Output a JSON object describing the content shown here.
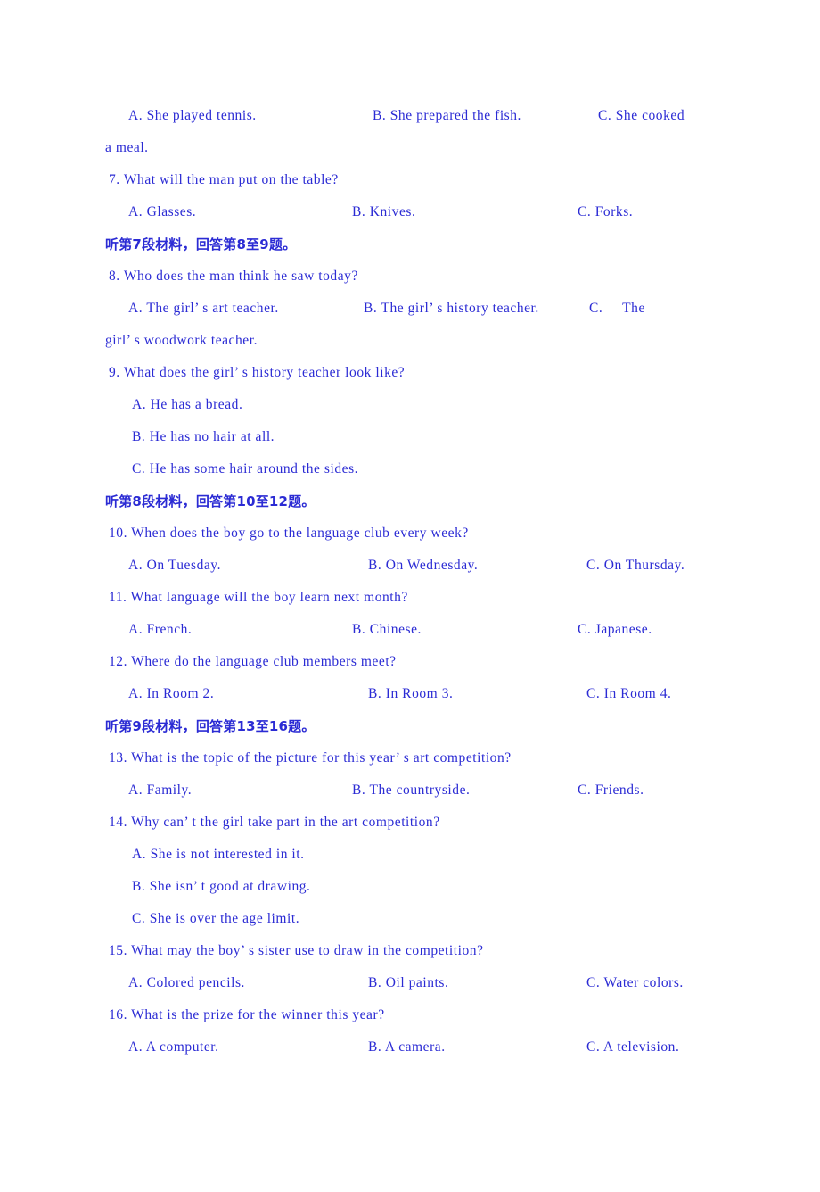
{
  "document": {
    "type": "listening-comprehension-exam-page",
    "language": "English with Chinese instructions",
    "text_color": "#2b2bd4",
    "background_color": "#ffffff"
  },
  "lines": [
    {
      "id": "q6-options",
      "kind": "options-row",
      "a": "A. She played tennis.",
      "b": "B. She prepared the fish.",
      "c": "C. She cooked"
    },
    {
      "id": "q6-continuation",
      "kind": "continuation",
      "text": "a meal."
    },
    {
      "id": "q7-stem",
      "kind": "stem",
      "text": "7. What will the man put on the table?"
    },
    {
      "id": "q7-options",
      "kind": "options-row",
      "a": "A. Glasses.",
      "b": "B. Knives.",
      "c": "C. Forks."
    },
    {
      "id": "section-7-header",
      "kind": "cn-header",
      "text": "听第7段材料，回答第8至9题。"
    },
    {
      "id": "q8-stem",
      "kind": "stem",
      "text": "8. Who does the man think he saw today?"
    },
    {
      "id": "q8-options",
      "kind": "options-row",
      "a": "A. The girl’ s art teacher.",
      "b": "B. The girl’ s history teacher.",
      "c": "C.     The"
    },
    {
      "id": "q8-continuation",
      "kind": "continuation",
      "text": "girl’ s woodwork teacher."
    },
    {
      "id": "q9-stem",
      "kind": "stem",
      "text": "9. What does the girl’ s history teacher look like?"
    },
    {
      "id": "q9-option-a",
      "kind": "stacked-option",
      "text": "A. He has a bread."
    },
    {
      "id": "q9-option-b",
      "kind": "stacked-option",
      "text": "B. He has no hair at all."
    },
    {
      "id": "q9-option-c",
      "kind": "stacked-option",
      "text": "C. He has some hair around the sides."
    },
    {
      "id": "section-8-header",
      "kind": "cn-header",
      "text": "听第8段材料，回答第10至12题。"
    },
    {
      "id": "q10-stem",
      "kind": "stem",
      "text": "10. When does the boy go to the language club every week?"
    },
    {
      "id": "q10-options",
      "kind": "options-row",
      "a": "A. On Tuesday.",
      "b": "B. On Wednesday.",
      "c": "C. On Thursday."
    },
    {
      "id": "q11-stem",
      "kind": "stem",
      "text": "11. What language will the boy learn next month?"
    },
    {
      "id": "q11-options",
      "kind": "options-row",
      "a": "A. French.",
      "b": "B. Chinese.",
      "c": "C. Japanese."
    },
    {
      "id": "q12-stem",
      "kind": "stem",
      "text": "12. Where do the language club members meet?"
    },
    {
      "id": "q12-options",
      "kind": "options-row",
      "a": "A. In Room 2.",
      "b": "B. In Room 3.",
      "c": "C. In Room 4."
    },
    {
      "id": "section-9-header",
      "kind": "cn-header",
      "text": "听第9段材料，回答第13至16题。"
    },
    {
      "id": "q13-stem",
      "kind": "stem",
      "text": "13. What is the topic of the picture for this year’ s art competition?"
    },
    {
      "id": "q13-options",
      "kind": "options-row",
      "a": "A. Family.",
      "b": "B. The countryside.",
      "c": "C. Friends."
    },
    {
      "id": "q14-stem",
      "kind": "stem",
      "text": "14. Why can’ t the girl take part in the art competition?"
    },
    {
      "id": "q14-option-a",
      "kind": "stacked-option",
      "text": "A. She is not interested in it."
    },
    {
      "id": "q14-option-b",
      "kind": "stacked-option",
      "text": "B. She isn’ t good at drawing."
    },
    {
      "id": "q14-option-c",
      "kind": "stacked-option",
      "text": "C. She is over the age limit."
    },
    {
      "id": "q15-stem",
      "kind": "stem",
      "text": "15. What may the boy’ s sister use to draw in the competition?"
    },
    {
      "id": "q15-options",
      "kind": "options-row",
      "a": "A. Colored pencils.",
      "b": "B. Oil paints.",
      "c": "C. Water colors."
    },
    {
      "id": "q16-stem",
      "kind": "stem",
      "text": "16. What is the prize for the winner this year?"
    },
    {
      "id": "q16-options",
      "kind": "options-row",
      "a": "A. A computer.",
      "b": "B. A camera.",
      "c": "C. A television."
    }
  ]
}
